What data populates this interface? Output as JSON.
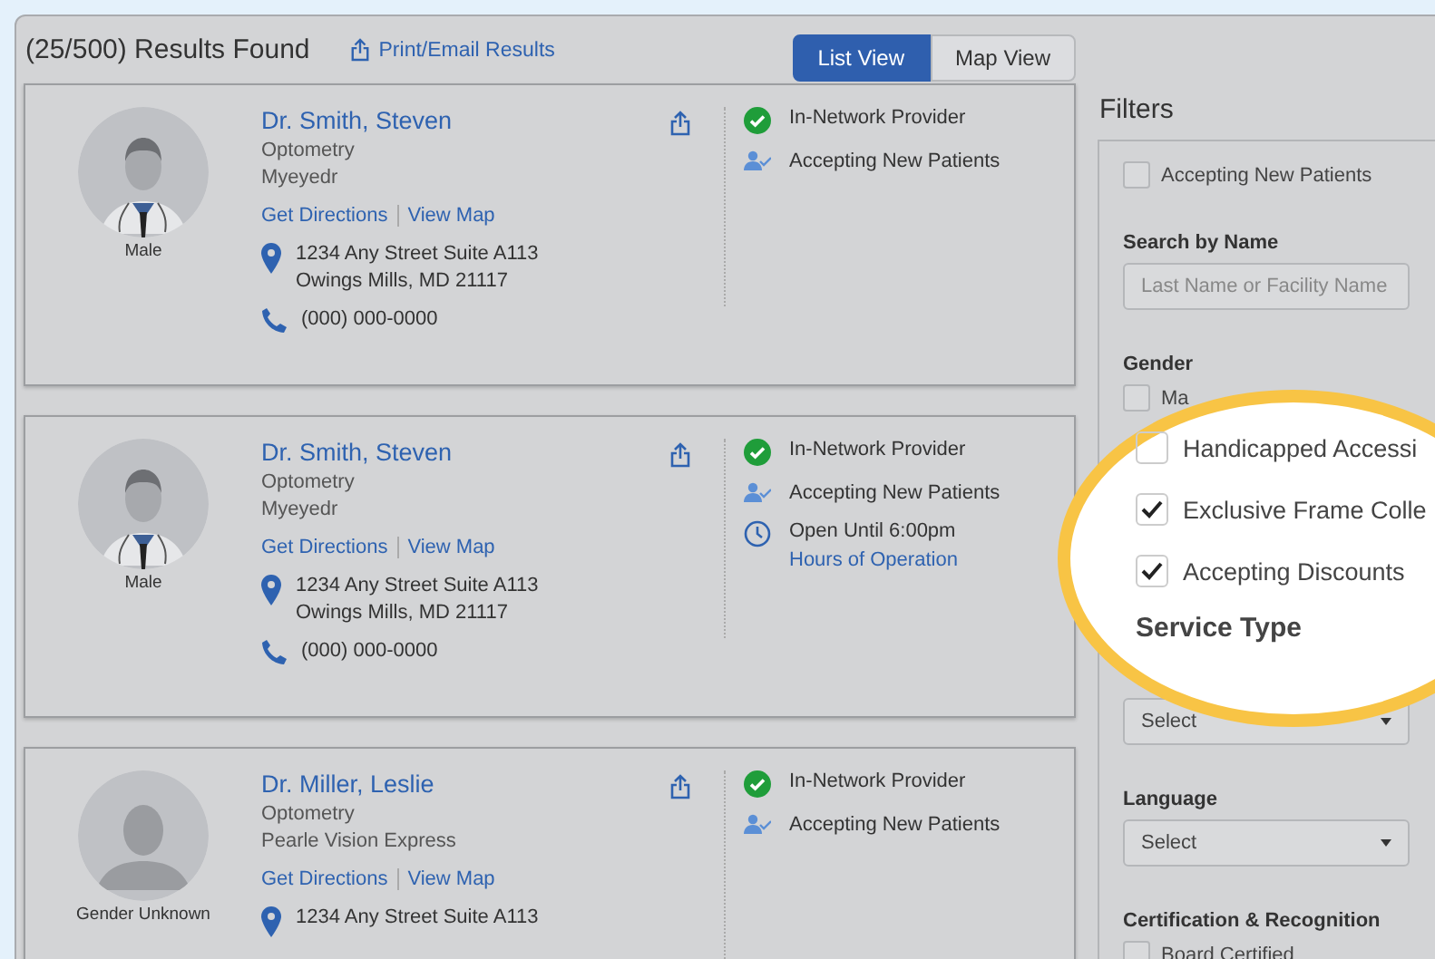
{
  "header": {
    "results": "(25/500) Results Found",
    "print_link": "Print/Email Results"
  },
  "view_tabs": [
    {
      "label": "List View",
      "selected": true
    },
    {
      "label": "Map View",
      "selected": false
    }
  ],
  "providers": [
    {
      "name": "Dr. Smith, Steven",
      "specialty": "Optometry",
      "practice": "Myeyedr",
      "avatar": {
        "kind": "doctor"
      },
      "gender": "Male",
      "links": [
        "Get Directions",
        "View Map"
      ],
      "address": [
        "1234 Any Street Suite A113",
        "Owings Mills, MD 21117"
      ],
      "phone": "(000) 000-0000",
      "badges": [
        {
          "kind": "network",
          "text": "In-Network Provider"
        },
        {
          "kind": "patients",
          "text": "Accepting New Patients"
        }
      ]
    },
    {
      "name": "Dr. Smith, Steven",
      "specialty": "Optometry",
      "practice": "Myeyedr",
      "avatar": {
        "kind": "doctor"
      },
      "gender": "Male",
      "links": [
        "Get Directions",
        "View Map"
      ],
      "address": [
        "1234 Any Street Suite A113",
        "Owings Mills, MD 21117"
      ],
      "phone": "(000) 000-0000",
      "badges": [
        {
          "kind": "network",
          "text": "In-Network Provider"
        },
        {
          "kind": "patients",
          "text": "Accepting New Patients"
        },
        {
          "kind": "hours",
          "text": "Open Until 6:00pm",
          "link": "Hours of Operation"
        }
      ]
    },
    {
      "name": "Dr. Miller, Leslie",
      "specialty": "Optometry",
      "practice": "Pearle Vision Express",
      "avatar": {
        "kind": "generic"
      },
      "gender": "Gender Unknown",
      "links": [
        "Get Directions",
        "View Map"
      ],
      "address": [
        "1234 Any Street Suite A113"
      ],
      "badges": [
        {
          "kind": "network",
          "text": "In-Network Provider"
        },
        {
          "kind": "patients",
          "text": "Accepting New Patients"
        }
      ]
    }
  ],
  "filters": {
    "title": "Filters",
    "accepting": {
      "label": "Accepting New Patients",
      "checked": false
    },
    "search_label": "Search by Name",
    "search": {
      "placeholder": "Last Name or Facility Name"
    },
    "gender_label": "Gender",
    "gender_options": [
      {
        "label": "Ma",
        "checked": false
      }
    ],
    "service_select": "Select",
    "language_label": "Language",
    "language_select": "Select",
    "certification_label": "Certification & Recognition",
    "certification_options": [
      {
        "label": "Board Certified",
        "checked": false
      }
    ]
  },
  "magnifier": {
    "options": [
      {
        "label": "Handicapped Accessi",
        "checked": false
      },
      {
        "label": "Exclusive Frame Colle",
        "checked": true
      },
      {
        "label": "Accepting Discounts",
        "checked": true
      }
    ],
    "heading": "Service Type"
  }
}
